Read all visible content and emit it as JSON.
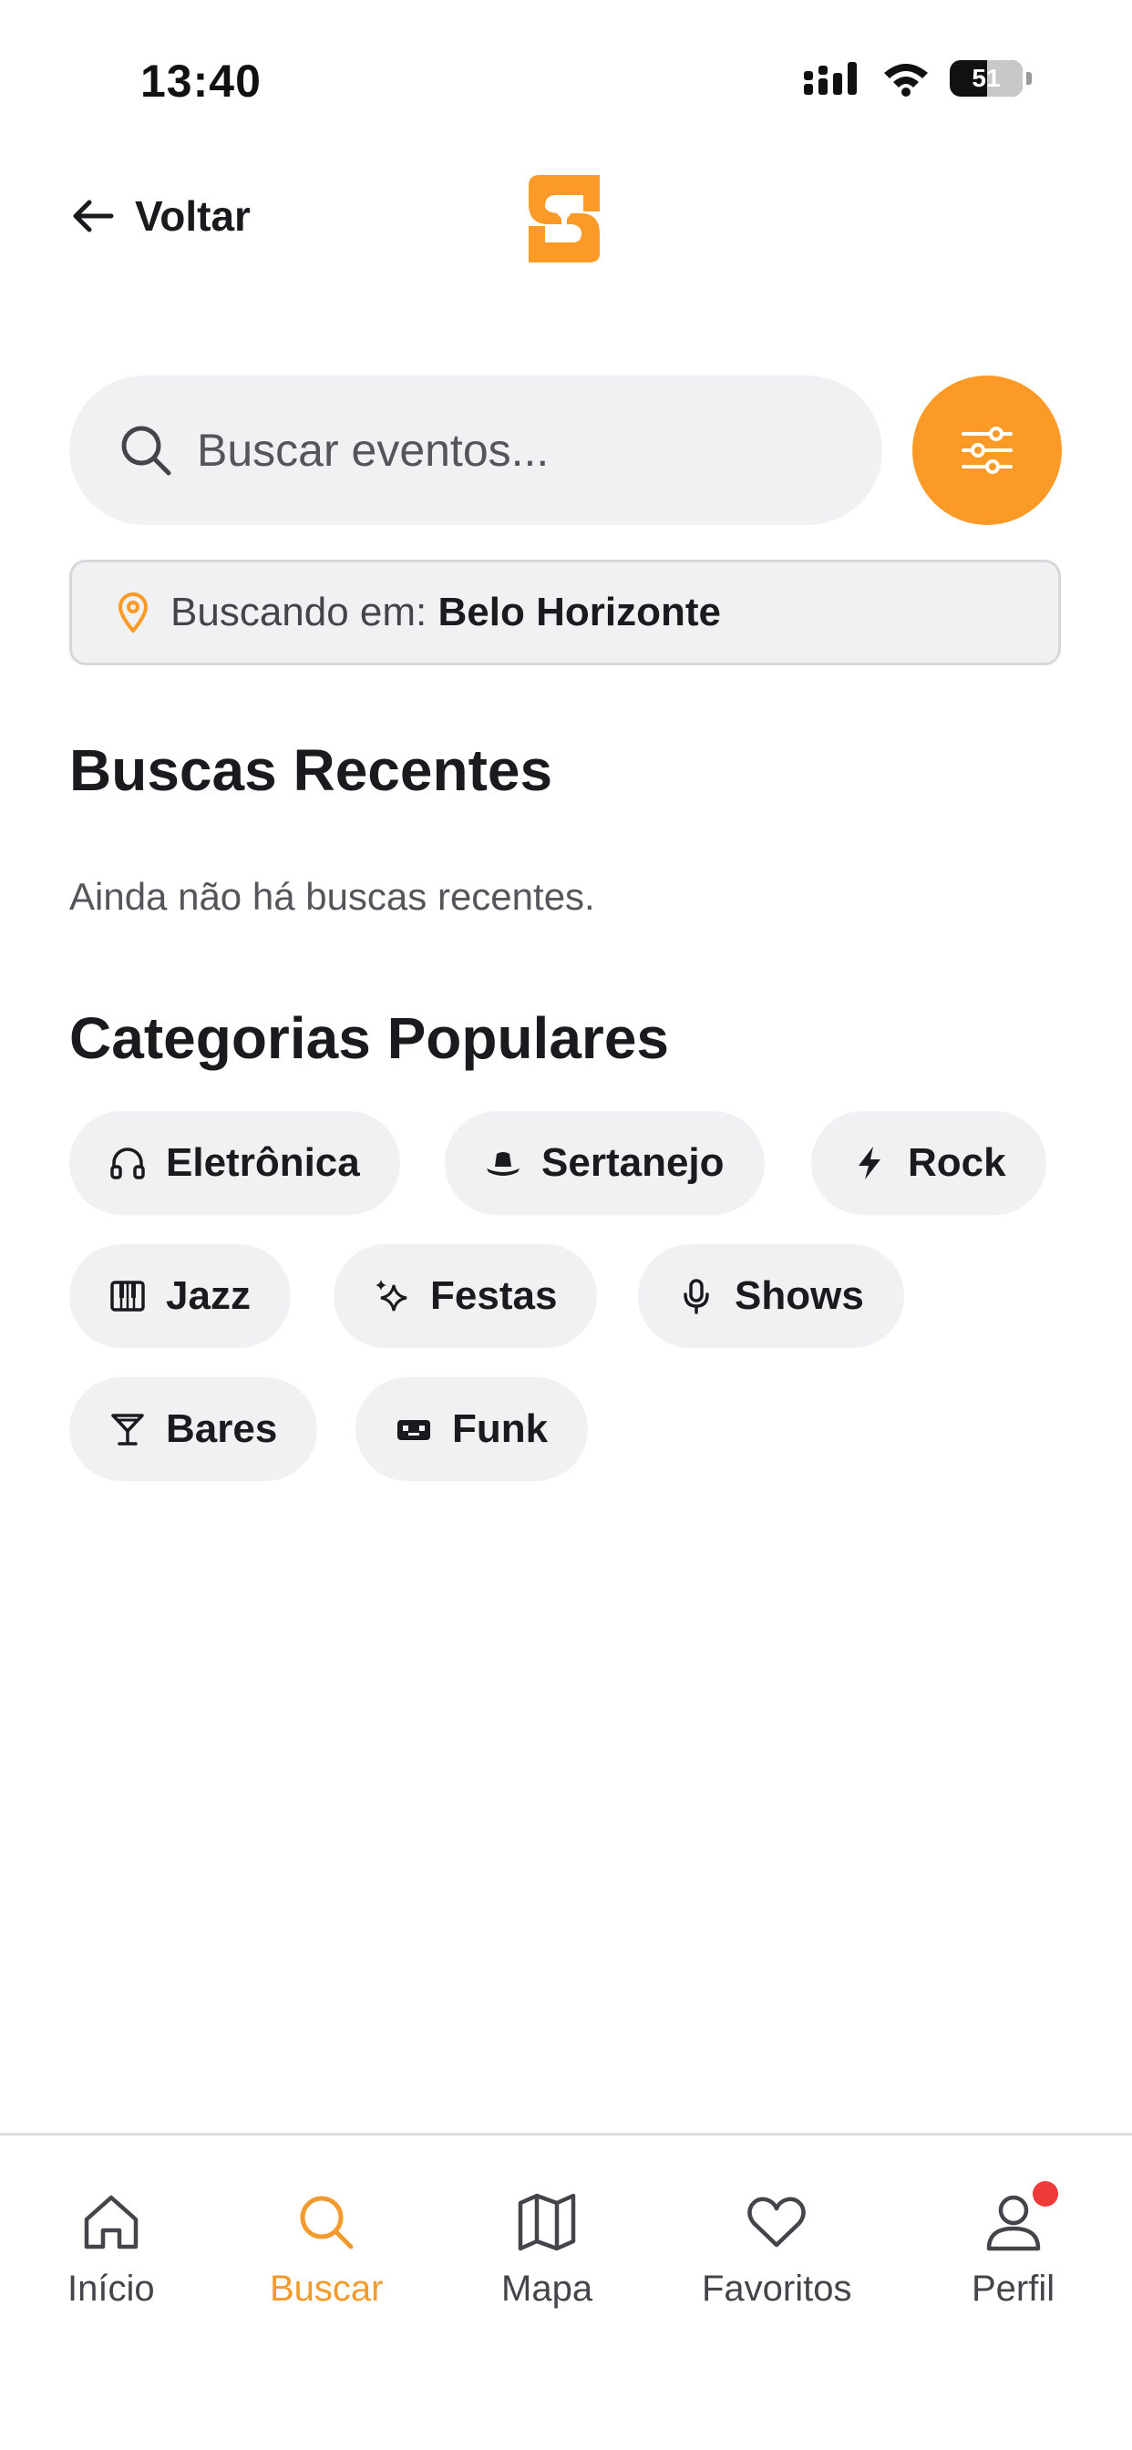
{
  "status": {
    "time": "13:40",
    "battery": "51"
  },
  "nav": {
    "back_label": "Voltar"
  },
  "search": {
    "placeholder": "Buscar eventos..."
  },
  "location": {
    "prefix": "Buscando em: ",
    "city": "Belo Horizonte"
  },
  "recent": {
    "title": "Buscas Recentes",
    "empty": "Ainda não há buscas recentes."
  },
  "categories": {
    "title": "Categorias Populares",
    "items": [
      {
        "label": "Eletrônica",
        "icon": "headphones-icon"
      },
      {
        "label": "Sertanejo",
        "icon": "cowboy-hat-icon"
      },
      {
        "label": "Rock",
        "icon": "lightning-icon"
      },
      {
        "label": "Jazz",
        "icon": "piano-icon"
      },
      {
        "label": "Festas",
        "icon": "sparkles-icon"
      },
      {
        "label": "Shows",
        "icon": "microphone-icon"
      },
      {
        "label": "Bares",
        "icon": "cocktail-icon"
      },
      {
        "label": "Funk",
        "icon": "boombox-icon"
      }
    ]
  },
  "tabs": [
    {
      "label": "Início",
      "icon": "home-icon"
    },
    {
      "label": "Buscar",
      "icon": "search-icon",
      "active": true
    },
    {
      "label": "Mapa",
      "icon": "map-icon"
    },
    {
      "label": "Favoritos",
      "icon": "heart-icon"
    },
    {
      "label": "Perfil",
      "icon": "user-icon"
    }
  ],
  "colors": {
    "accent": "#fb9a26",
    "chip_bg": "#f1f1f4",
    "notification": "#ef3a3a"
  }
}
